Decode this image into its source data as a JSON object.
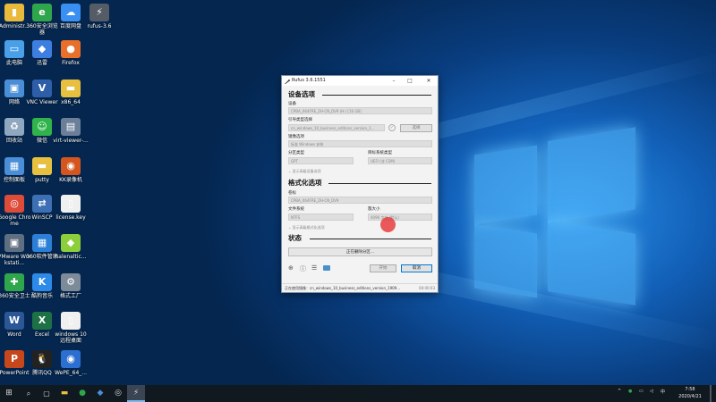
{
  "desktop": {
    "icons": [
      {
        "label": "Administr...",
        "icon": "user-folder-icon",
        "color": "#e8b93a",
        "glyph": "▮"
      },
      {
        "label": "360安全浏览器",
        "icon": "browser-360-icon",
        "color": "#2fa64b",
        "glyph": "e"
      },
      {
        "label": "百度网盘",
        "icon": "baidu-netdisk-icon",
        "color": "#3a8ff2",
        "glyph": "☁"
      },
      {
        "label": "rufus-3.6",
        "icon": "rufus-icon",
        "color": "#555c66",
        "glyph": "⚡"
      },
      {
        "label": "此电脑",
        "icon": "computer-icon",
        "color": "#4aa0e8",
        "glyph": "▭"
      },
      {
        "label": "迅雷",
        "icon": "xunlei-icon",
        "color": "#3d7ee0",
        "glyph": "◆"
      },
      {
        "label": "Firefox",
        "icon": "firefox-icon",
        "color": "#e8702a",
        "glyph": "●"
      },
      {
        "label": "网络",
        "icon": "network-icon",
        "color": "#4a8ed8",
        "glyph": "▣"
      },
      {
        "label": "VNC Viewer",
        "icon": "vnc-icon",
        "color": "#2f5ea8",
        "glyph": "V"
      },
      {
        "label": "x86_64",
        "icon": "folder-icon",
        "color": "#e8c040",
        "glyph": "▬"
      },
      {
        "label": "回收站",
        "icon": "recycle-bin-icon",
        "color": "#8fa7bf",
        "glyph": "♻"
      },
      {
        "label": "微信",
        "icon": "wechat-icon",
        "color": "#2fb34a",
        "glyph": "☺"
      },
      {
        "label": "virt-viewer-...",
        "icon": "virt-viewer-icon",
        "color": "#6b7f99",
        "glyph": "▤"
      },
      {
        "label": "控制面板",
        "icon": "control-panel-icon",
        "color": "#4a8ed8",
        "glyph": "▦"
      },
      {
        "label": "putty",
        "icon": "putty-icon",
        "color": "#e8c040",
        "glyph": "▬"
      },
      {
        "label": "KK录像机",
        "icon": "kk-recorder-icon",
        "color": "#d4561e",
        "glyph": "◉"
      },
      {
        "label": "Google Chrome",
        "icon": "chrome-icon",
        "color": "#dd4b39",
        "glyph": "◎"
      },
      {
        "label": "WinSCP",
        "icon": "winscp-icon",
        "color": "#3d6fb4",
        "glyph": "⇄"
      },
      {
        "label": "license.key",
        "icon": "file-icon",
        "color": "#f0f0f0",
        "glyph": "▯"
      },
      {
        "label": "VMware Workstati...",
        "icon": "vmware-icon",
        "color": "#5f6e80",
        "glyph": "▣"
      },
      {
        "label": "360软件管家",
        "icon": "360-software-icon",
        "color": "#2c7fd6",
        "glyph": "▦"
      },
      {
        "label": "halenaltic...",
        "icon": "halen-icon",
        "color": "#8ccf3a",
        "glyph": "◆"
      },
      {
        "label": "360安全卫士",
        "icon": "360-security-icon",
        "color": "#2fa64b",
        "glyph": "✚"
      },
      {
        "label": "酷狗音乐",
        "icon": "kugou-icon",
        "color": "#2c8ae8",
        "glyph": "K"
      },
      {
        "label": "格式工厂",
        "icon": "format-factory-icon",
        "color": "#7d8a99",
        "glyph": "⚙"
      },
      {
        "label": "Word",
        "icon": "word-icon",
        "color": "#2b5797",
        "glyph": "W"
      },
      {
        "label": "Excel",
        "icon": "excel-icon",
        "color": "#1e7145",
        "glyph": "X"
      },
      {
        "label": "windows 10 远程桌面",
        "icon": "file-icon",
        "color": "#f0f0f0",
        "glyph": "▯"
      },
      {
        "label": "PowerPoint",
        "icon": "powerpoint-icon",
        "color": "#c5471b",
        "glyph": "P"
      },
      {
        "label": "腾讯QQ",
        "icon": "qq-icon",
        "color": "#222222",
        "glyph": "🐧"
      },
      {
        "label": "WePE_64_...",
        "icon": "wepe-icon",
        "color": "#2c6fd0",
        "glyph": "◉"
      }
    ]
  },
  "window": {
    "title": "Rufus 3.6.1551",
    "device_section": "设备选项",
    "device_label": "设备",
    "device_value": "CPBA_X64FRE_ZH-CN_DV9 (H:) [16 GB]",
    "boot_label": "引导类型选择",
    "boot_value": "cn_windows_10_business_editions_version_1...",
    "select_button": "选择",
    "image_label": "镜像选项",
    "image_value": "标准 Windows 安装",
    "partition_label": "分区类型",
    "partition_value": "GPT",
    "target_label": "目标系统类型",
    "target_value": "UEFI (非 CSM)",
    "adv_drive": "显示高级设备选项",
    "format_section": "格式化选项",
    "volume_label": "卷标",
    "volume_value": "CPBA_X64FRE_ZH-CN_DV9",
    "fs_label": "文件系统",
    "fs_value": "NTFS",
    "cluster_label": "簇大小",
    "cluster_value": "4096 字节 (默认)",
    "adv_format": "显示高级格式化选项",
    "status_section": "状态",
    "progress_text": "正在删除分区...",
    "start_button": "开始",
    "cancel_button": "取消",
    "status_text": "正在使用镜像：cn_windows_10_business_editions_version_1909...",
    "elapsed": "00:00:03"
  },
  "taskbar": {
    "time": "7:58",
    "date": "2020/4/21",
    "ime": "中"
  }
}
